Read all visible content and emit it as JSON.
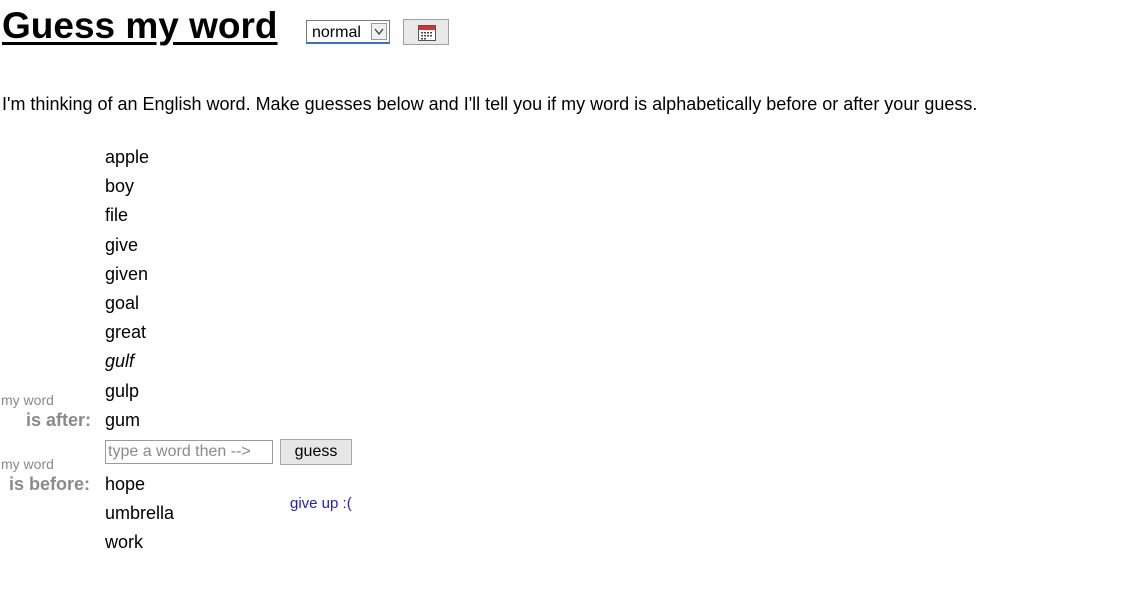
{
  "header": {
    "title": "Guess my word",
    "mode_value": "normal",
    "calendar_icon": "calendar-icon"
  },
  "intro": "I'm thinking of an English word. Make guesses below and I'll tell you if my word is alphabetically before or after your guess.",
  "after_words": [
    {
      "text": "apple",
      "italic": false
    },
    {
      "text": "boy",
      "italic": false
    },
    {
      "text": "file",
      "italic": false
    },
    {
      "text": "give",
      "italic": false
    },
    {
      "text": "given",
      "italic": false
    },
    {
      "text": "goal",
      "italic": false
    },
    {
      "text": "great",
      "italic": false
    },
    {
      "text": "gulf",
      "italic": true
    },
    {
      "text": "gulp",
      "italic": false
    },
    {
      "text": "gum",
      "italic": false
    }
  ],
  "before_words": [
    {
      "text": "hope"
    },
    {
      "text": "umbrella"
    },
    {
      "text": "work"
    }
  ],
  "labels": {
    "after_small": "my word",
    "after_big": "is after:",
    "before_small": "my word",
    "before_big": "is before:"
  },
  "input": {
    "value": "",
    "placeholder": "type a word then -->"
  },
  "guess_button": "guess",
  "give_up": "give up :(",
  "colors": {
    "label_gray": "#8a8a8a",
    "link_blue": "#1a1ad0"
  }
}
